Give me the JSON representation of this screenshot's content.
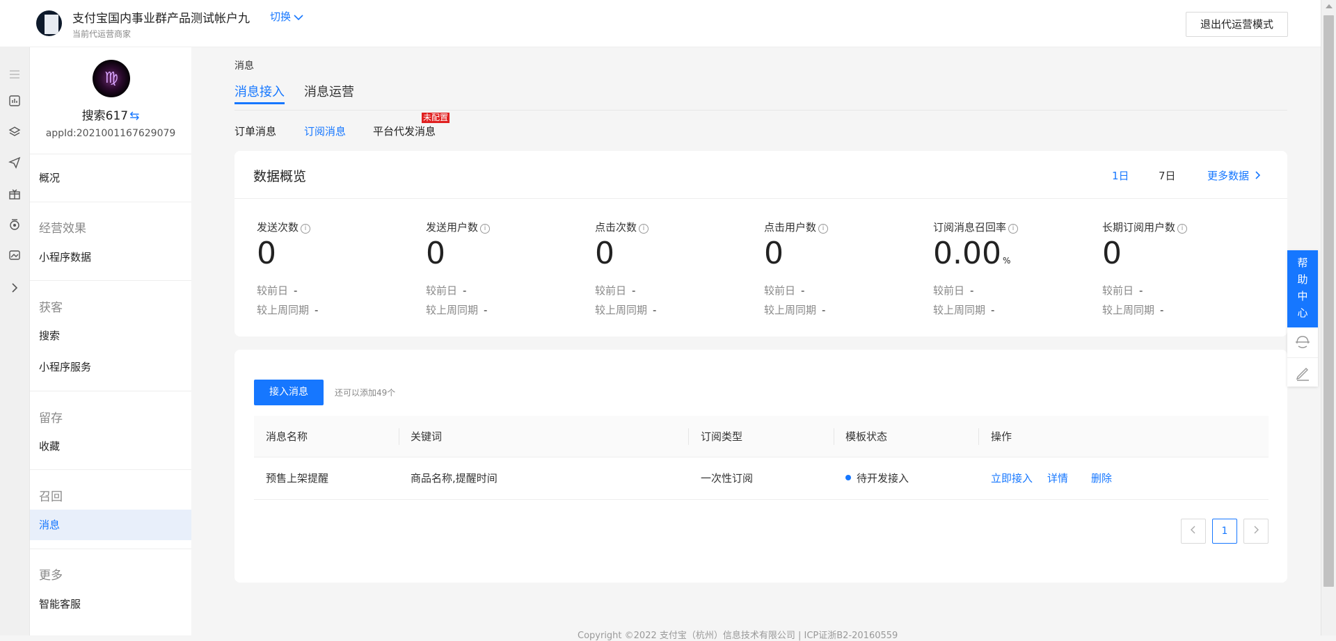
{
  "header": {
    "account_name": "支付宝国内事业群产品测试帐户九",
    "switch_label": "切换",
    "account_role": "当前代运营商家",
    "exit_button": "退出代运营模式"
  },
  "app": {
    "name": "搜索617",
    "swap_icon": "⇆",
    "appid": "appId:2021001167629079",
    "avatar_glyph": "♍"
  },
  "sidebar": {
    "overview": "概况",
    "sections": [
      {
        "title": "经营效果",
        "items": [
          "小程序数据"
        ]
      },
      {
        "title": "获客",
        "items": [
          "搜索",
          "小程序服务"
        ]
      },
      {
        "title": "留存",
        "items": [
          "收藏"
        ]
      },
      {
        "title": "召回",
        "items": [
          "消息"
        ]
      },
      {
        "title": "更多",
        "items": [
          "智能客服"
        ]
      }
    ],
    "active_item": "消息"
  },
  "breadcrumb": "消息",
  "tabs": [
    "消息接入",
    "消息运营"
  ],
  "subtabs": [
    "订单消息",
    "订阅消息",
    "平台代发消息"
  ],
  "subtab_badge": "未配置",
  "overview": {
    "title": "数据概览",
    "range_options": [
      "1日",
      "7日"
    ],
    "more_data": "更多数据",
    "compare_day": "较前日",
    "compare_week": "较上周同期",
    "stats": [
      {
        "label": "发送次数",
        "value": "0",
        "unit": "",
        "day": "-",
        "week": "-"
      },
      {
        "label": "发送用户数",
        "value": "0",
        "unit": "",
        "day": "-",
        "week": "-"
      },
      {
        "label": "点击次数",
        "value": "0",
        "unit": "",
        "day": "-",
        "week": "-"
      },
      {
        "label": "点击用户数",
        "value": "0",
        "unit": "",
        "day": "-",
        "week": "-"
      },
      {
        "label": "订阅消息召回率",
        "value": "0.00",
        "unit": "%",
        "day": "-",
        "week": "-"
      },
      {
        "label": "长期订阅用户数",
        "value": "0",
        "unit": "",
        "day": "-",
        "week": "-"
      }
    ]
  },
  "messages": {
    "add_button": "接入消息",
    "add_hint": "还可以添加49个",
    "columns": [
      "消息名称",
      "关键词",
      "订阅类型",
      "模板状态",
      "操作"
    ],
    "rows": [
      {
        "name": "预售上架提醒",
        "keywords": "商品名称,提醒时间",
        "type": "一次性订阅",
        "status": "待开发接入",
        "actions": [
          "立即接入",
          "详情",
          "删除"
        ]
      }
    ],
    "page": "1"
  },
  "help": {
    "label_chars": [
      "帮",
      "助",
      "中",
      "心"
    ]
  },
  "footer": "Copyright ©2022 支付宝（杭州）信息技术有限公司 | ICP证浙B2-20160559",
  "colors": {
    "accent": "#1677ff",
    "badge": "#e02020"
  }
}
